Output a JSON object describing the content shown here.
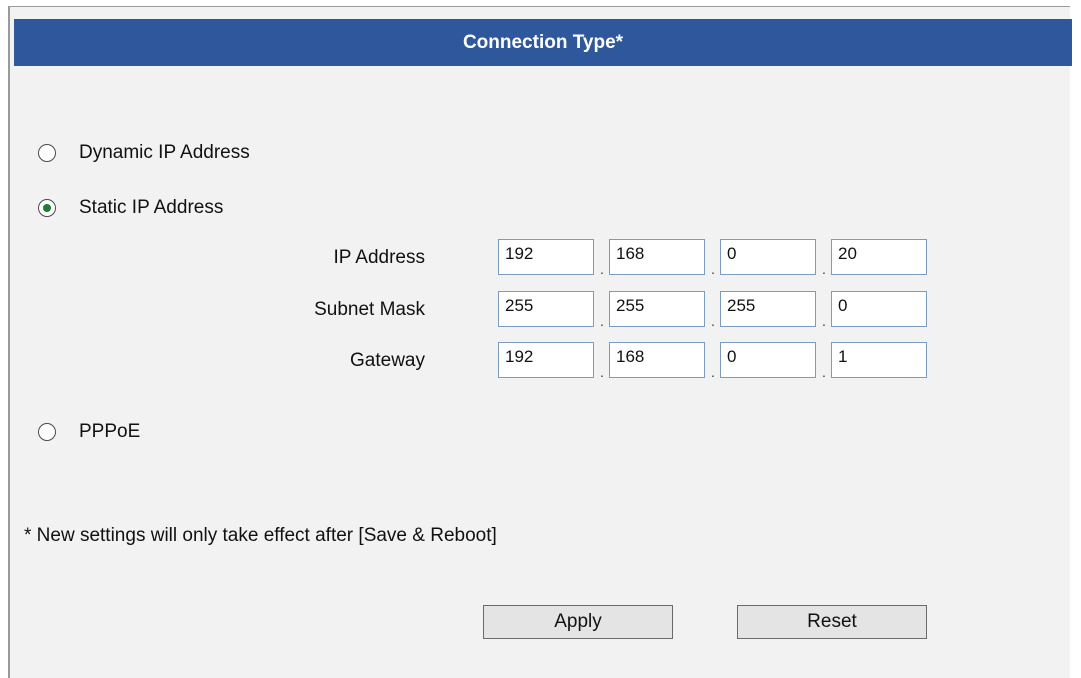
{
  "header": {
    "title": "Connection Type*"
  },
  "connection_options": [
    {
      "label": "Dynamic IP Address",
      "selected": false
    },
    {
      "label": "Static IP Address",
      "selected": true
    },
    {
      "label": "PPPoE",
      "selected": false
    }
  ],
  "static": {
    "ip_address": {
      "label": "IP Address",
      "octets": [
        "192",
        "168",
        "0",
        "20"
      ]
    },
    "subnet_mask": {
      "label": "Subnet Mask",
      "octets": [
        "255",
        "255",
        "255",
        "0"
      ]
    },
    "gateway": {
      "label": "Gateway",
      "octets": [
        "192",
        "168",
        "0",
        "1"
      ]
    },
    "separator": "."
  },
  "note": "* New settings will only take effect after [Save & Reboot]",
  "buttons": {
    "apply": "Apply",
    "reset": "Reset"
  },
  "colors": {
    "header_bg": "#2f579b",
    "panel_bg": "#f2f2f2",
    "radio_selected": "#1f7a34"
  }
}
